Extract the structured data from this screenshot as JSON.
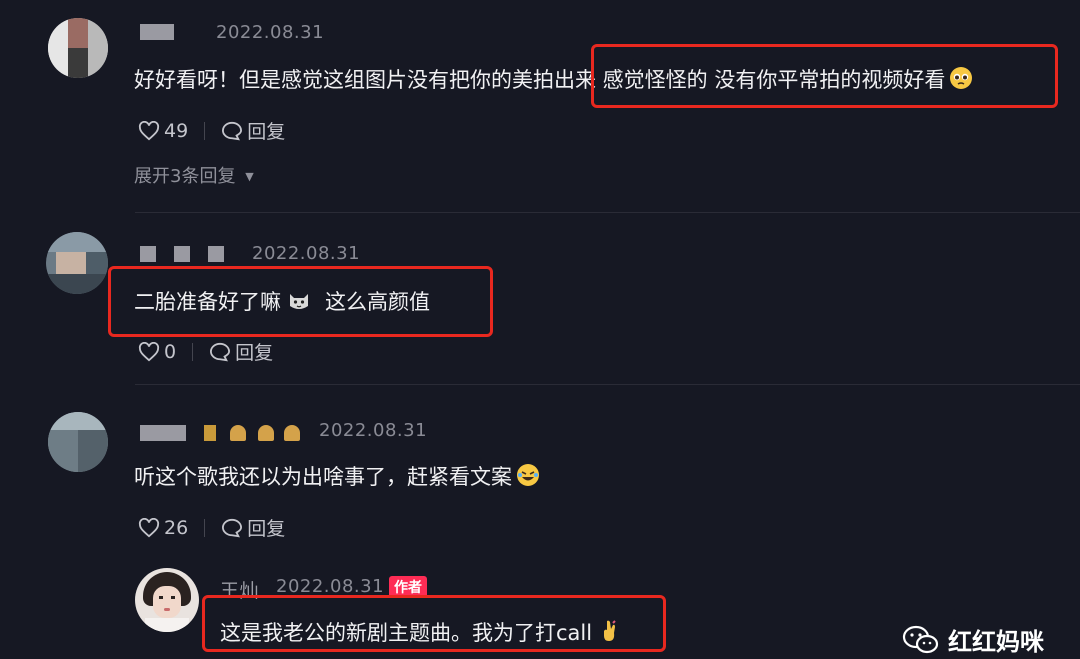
{
  "comments": [
    {
      "date": "2022.08.31",
      "text": "好好看呀！但是感觉这组图片没有把你的美拍出来 感觉怪怪的 没有你平常拍的视频好看",
      "emoji_icon": "pleading-face-emoji",
      "likes": "49",
      "reply_label": "回复",
      "expand_label": "展开3条回复"
    },
    {
      "date": "2022.08.31",
      "text_before": "二胎准备好了嘛",
      "emoji_icon": "cat-emoji",
      "text_after": "这么高颜值",
      "likes": "0",
      "reply_label": "回复"
    },
    {
      "date": "2022.08.31",
      "text": "听这个歌我还以为出啥事了，赶紧看文案",
      "emoji_icon": "rofl-emoji",
      "likes": "26",
      "reply_label": "回复"
    }
  ],
  "reply": {
    "username": "王灿",
    "date": "2022.08.31",
    "badge": "作者",
    "text": "这是我老公的新剧主题曲。我为了打call",
    "emoji_icon": "fingers-crossed-emoji"
  },
  "watermark": {
    "icon": "wechat-icon",
    "text": "红红妈咪"
  },
  "colors": {
    "background": "#161823",
    "highlight_box": "#e8281f",
    "author_badge": "#fe2c55"
  }
}
